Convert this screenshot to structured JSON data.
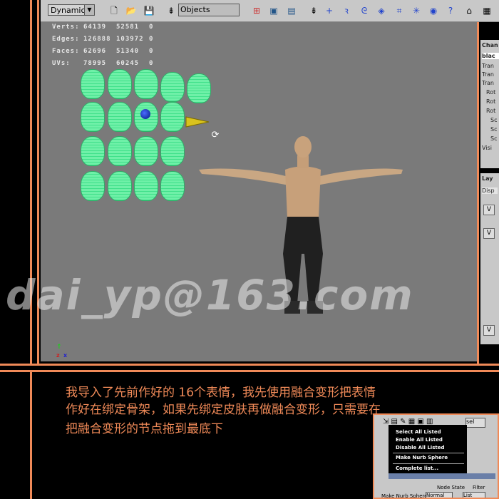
{
  "shelf": {
    "mode_label": "Dynamics",
    "objects_label": "Objects"
  },
  "hud": {
    "rows": [
      {
        "label": "Verts:",
        "v1": "64139",
        "v2": "52581",
        "v3": "0"
      },
      {
        "label": "Edges:",
        "v1": "126888",
        "v2": "103972",
        "v3": "0"
      },
      {
        "label": "Faces:",
        "v1": "62696",
        "v2": "51340",
        "v3": "0"
      },
      {
        "label": "UVs:",
        "v1": "78995",
        "v2": "60245",
        "v3": "0"
      }
    ]
  },
  "viewport": {
    "axis_x": "x",
    "axis_z": "z",
    "watermark": "dai_yp@163.com"
  },
  "channel_box": {
    "title": "Chan",
    "object": "blac",
    "attrs": [
      "Tran",
      "Tran",
      "Tran",
      "Rot",
      "Rot",
      "Rot",
      "Sc",
      "Sc",
      "Sc",
      "Visi"
    ]
  },
  "layer_editor": {
    "title": "Lay",
    "tab": "Disp",
    "vis": [
      "V",
      "V",
      "V"
    ]
  },
  "caption": {
    "line1": "我导入了先前作好的 16个表情，我先使用融合变形把表情",
    "line2": "作好在绑定骨架，如果先绑定皮肤再做融合变形，只需要在",
    "line3": "把融合变形的节点拖到最底下"
  },
  "inset_menu": {
    "items": [
      "Select All Listed",
      "Enable All Listed",
      "Disable All Listed",
      "Make Nurb Sphere",
      "Complete list..."
    ],
    "sel_label": "sel",
    "node_state": "Node State",
    "filter": "Filter",
    "bottom_left": "Make Nurb Sphere",
    "normal": "Normal",
    "list": "List"
  },
  "colors": {
    "accent": "#f08a58",
    "blendshape": "#5fe89a",
    "viewport": "#7a7a7a"
  }
}
